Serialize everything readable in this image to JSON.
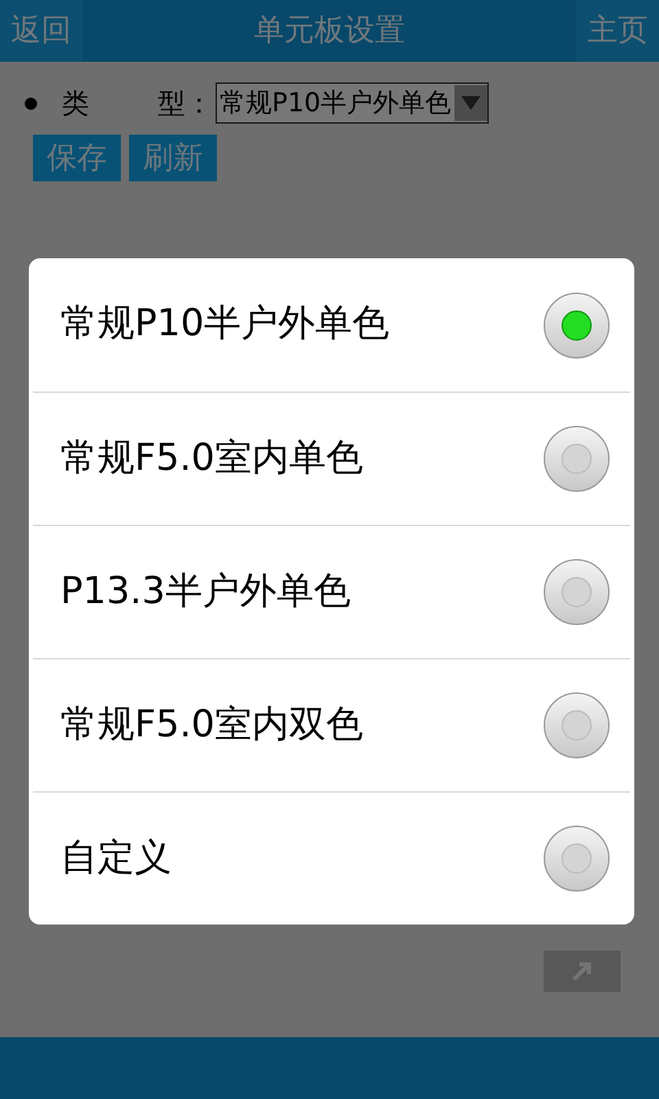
{
  "header": {
    "back": "返回",
    "title": "单元板设置",
    "home": "主页"
  },
  "type_row": {
    "label_1": "类",
    "label_2": "型：",
    "value": "常规P10半户外单色"
  },
  "buttons": [
    "保存",
    "刷新"
  ],
  "dialog": {
    "options": [
      {
        "label": "常规P10半户外单色",
        "selected": true
      },
      {
        "label": "常规F5.0室内单色",
        "selected": false
      },
      {
        "label": "P13.3半户外单色",
        "selected": false
      },
      {
        "label": "常规F5.0室内双色",
        "selected": false
      },
      {
        "label": "自定义",
        "selected": false
      }
    ]
  }
}
